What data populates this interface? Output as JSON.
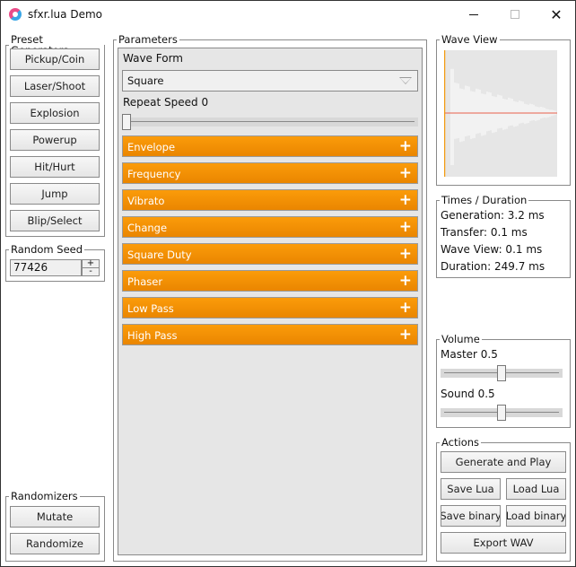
{
  "window": {
    "title": "sfxr.lua Demo",
    "controls": {
      "minimize": "minimize-icon",
      "maximize": "maximize-icon",
      "close": "close-icon"
    },
    "app_icon": "app-heart-icon"
  },
  "preset_generators": {
    "legend": "Preset Generators",
    "buttons": [
      "Pickup/Coin",
      "Laser/Shoot",
      "Explosion",
      "Powerup",
      "Hit/Hurt",
      "Jump",
      "Blip/Select"
    ]
  },
  "random_seed": {
    "legend": "Random Seed",
    "value": "77426",
    "increment": "+",
    "decrement": "-"
  },
  "randomizers": {
    "legend": "Randomizers",
    "buttons": [
      "Mutate",
      "Randomize"
    ]
  },
  "parameters": {
    "legend": "Parameters",
    "wave_form_label": "Wave Form",
    "wave_form_value": "Square",
    "repeat_speed_label": "Repeat Speed 0",
    "repeat_speed_value": 0,
    "sections": [
      "Envelope",
      "Frequency",
      "Vibrato",
      "Change",
      "Square Duty",
      "Phaser",
      "Low Pass",
      "High Pass"
    ],
    "expand_symbol": "+"
  },
  "wave_view": {
    "legend": "Wave View",
    "colors": {
      "background": "#e6e6e6",
      "wave": "#ffffff",
      "axis": "#f39c12",
      "center": "#e8604c"
    }
  },
  "times": {
    "legend": "Times / Duration",
    "generation": "Generation: 3.2 ms",
    "transfer": "Transfer: 0.1 ms",
    "wave_view": "Wave View: 0.1 ms",
    "duration": "Duration: 249.7 ms"
  },
  "volume": {
    "legend": "Volume",
    "master_label": "Master 0.5",
    "master_value": 0.5,
    "sound_label": "Sound 0.5",
    "sound_value": 0.5
  },
  "actions": {
    "legend": "Actions",
    "generate_and_play": "Generate and Play",
    "save_lua": "Save Lua",
    "load_lua": "Load Lua",
    "save_binary": "Save binary",
    "load_binary": "Load binary",
    "export_wav": "Export WAV"
  },
  "colors": {
    "accent": "#f39200",
    "panel": "#e6e6e6",
    "border": "#8a8a8a"
  }
}
